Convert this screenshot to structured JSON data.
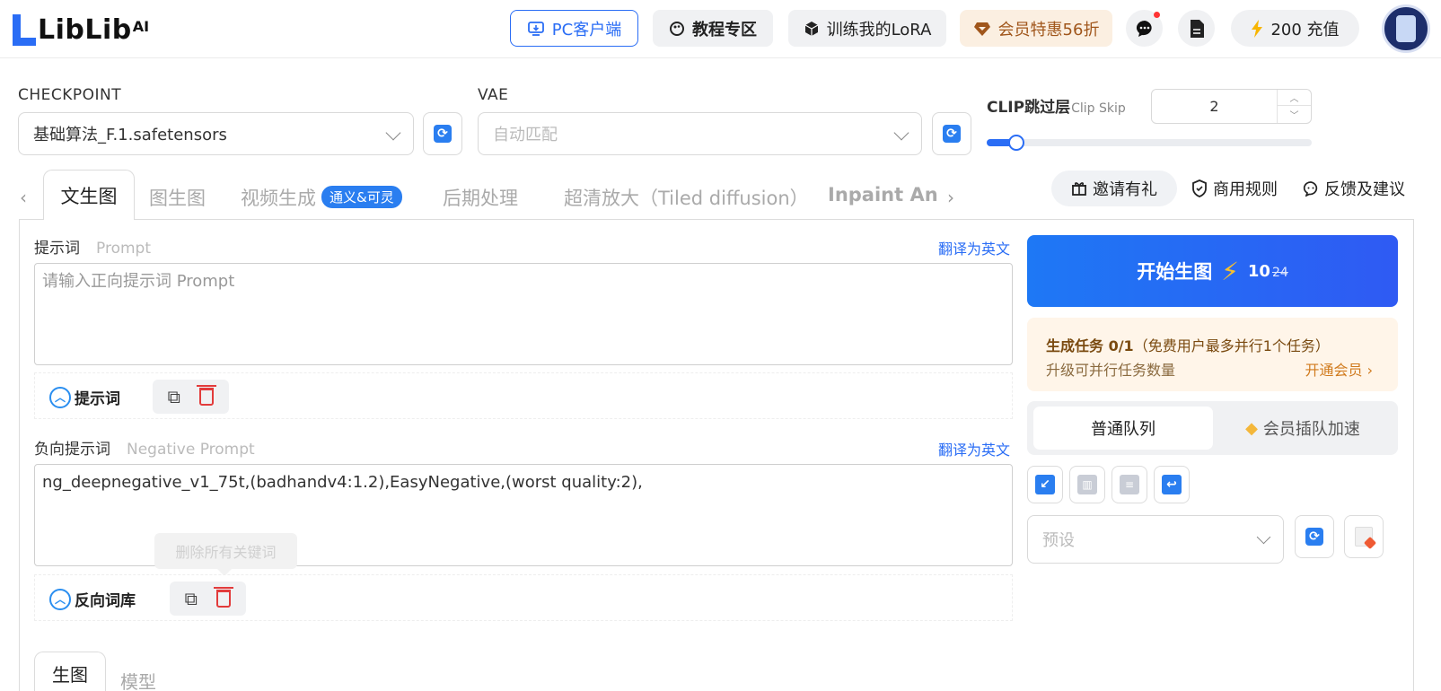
{
  "header": {
    "logo_text": "LibLib",
    "logo_sup": "AI",
    "pc_client": "PC客户端",
    "tutorials": "教程专区",
    "train_lora": "训练我的LoRA",
    "vip_offer": "会员特惠56折",
    "recharge": "200 充值",
    "icons": [
      "desktop-icon",
      "palette-icon",
      "cube-icon",
      "diamond-icon",
      "chat-icon",
      "document-icon",
      "bolt-icon",
      "avatar"
    ]
  },
  "config": {
    "checkpoint_label": "CHECKPOINT",
    "checkpoint_value": "基础算法_F.1.safetensors",
    "vae_label": "VAE",
    "vae_placeholder": "自动匹配",
    "clip_label": "CLIP跳过层",
    "clip_sub": "Clip Skip",
    "clip_value": "2",
    "clip_slider_fraction": 0.09
  },
  "tabs": {
    "items": [
      "文生图",
      "图生图",
      "视频生成",
      "后期处理",
      "超清放大（Tiled diffusion）",
      "Inpaint Anyt"
    ],
    "video_badge": "通义&可灵",
    "active": "文生图"
  },
  "top_links": {
    "invite": "邀请有礼",
    "commercial_rules": "商用规则",
    "feedback": "反馈及建议"
  },
  "prompt": {
    "title": "提示词",
    "title_en": "Prompt",
    "translate": "翻译为英文",
    "placeholder": "请输入正向提示词 Prompt",
    "toggle_label": "提示词"
  },
  "negative": {
    "title": "负向提示词",
    "title_en": "Negative Prompt",
    "translate": "翻译为英文",
    "value": "ng_deepnegative_v1_75t,(badhandv4:1.2),EasyNegative,(worst quality:2),",
    "toggle_label": "反向词库",
    "tooltip": "删除所有关键词"
  },
  "bottom_tabs": [
    "生图",
    "模型"
  ],
  "generate": {
    "label": "开始生图",
    "cost": "10",
    "original_cost": "24"
  },
  "task_notice": {
    "line1": "生成任务 0/1",
    "line1_note": "（免费用户最多并行1个任务）",
    "line2": "升级可并行任务数量",
    "link": "开通会员 ›"
  },
  "queue": {
    "normal": "普通队列",
    "vip": "会员插队加速"
  },
  "preset": {
    "placeholder": "预设"
  },
  "colors": {
    "accent": "#2a6df5",
    "danger": "#e23b3b",
    "vip_bg": "#fbefe1",
    "notice_bg": "#fff5e9"
  }
}
